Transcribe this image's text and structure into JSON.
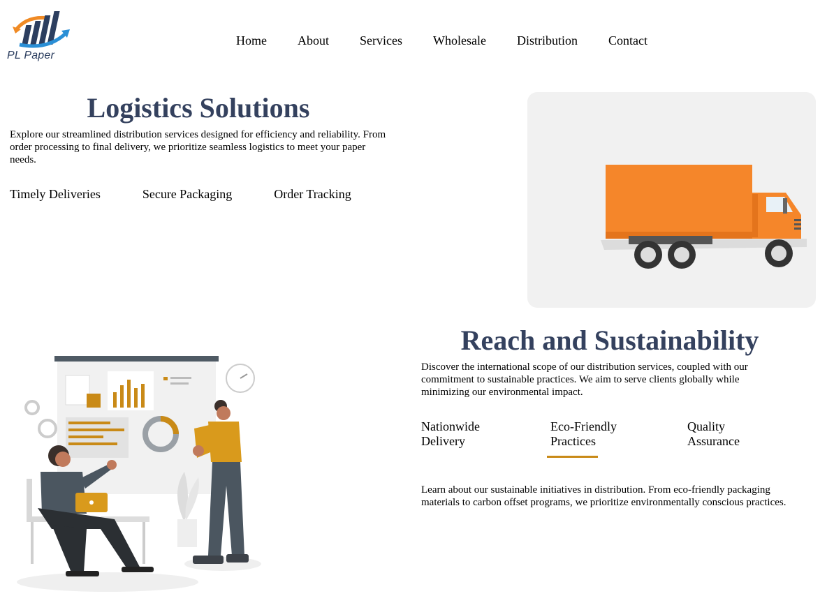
{
  "brand": {
    "name": "PL Paper",
    "logo_icon": "bar-chart-arrows-logo",
    "colors": {
      "orange": "#f08a24",
      "navy": "#2c3e5f",
      "blue": "#2a8fd6"
    }
  },
  "nav": {
    "items": [
      "Home",
      "About",
      "Services",
      "Wholesale",
      "Distribution",
      "Contact"
    ]
  },
  "section_logistics": {
    "title": "Logistics Solutions",
    "description": "Explore our streamlined distribution services designed for efficiency and reliability. From order processing to final delivery, we prioritize seamless logistics to meet your paper needs.",
    "features": [
      "Timely Deliveries",
      "Secure Packaging",
      "Order Tracking"
    ],
    "image_icon": "orange-delivery-truck-illustration"
  },
  "section_reach": {
    "title": "Reach and Sustainability",
    "description": "Discover the international scope of our distribution services, coupled with our commitment to sustainable practices. We aim to serve clients globally while minimizing our environmental impact.",
    "tabs": [
      "Nationwide Delivery",
      "Eco-Friendly Practices",
      "Quality Assurance"
    ],
    "active_tab": "Eco-Friendly Practices",
    "active_content": "Learn about our sustainable initiatives in distribution. From eco-friendly packaging materials to carbon offset programs, we prioritize environmentally conscious practices.",
    "image_icon": "business-team-presentation-illustration",
    "accent_color": "#c98a17"
  }
}
